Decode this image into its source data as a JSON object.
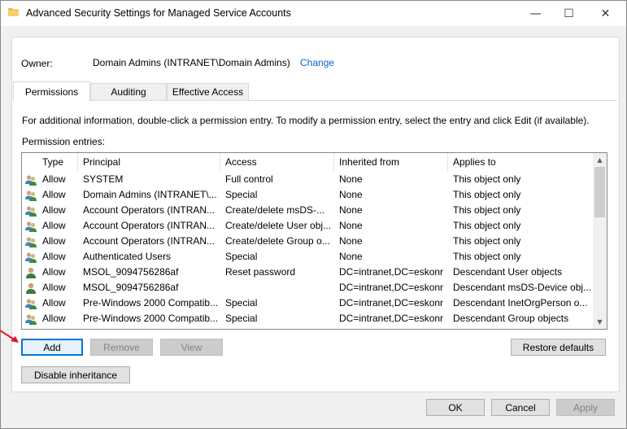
{
  "window": {
    "title": "Advanced Security Settings for Managed Service Accounts",
    "minimize_glyph": "—",
    "maximize_glyph": "☐",
    "close_glyph": "✕"
  },
  "owner": {
    "label": "Owner:",
    "value": "Domain Admins (INTRANET\\Domain Admins)",
    "change_link": "Change"
  },
  "tabs": [
    {
      "label": "Permissions",
      "active": true
    },
    {
      "label": "Auditing",
      "active": false
    },
    {
      "label": "Effective Access",
      "active": false
    }
  ],
  "permissions": {
    "info_text": "For additional information, double-click a permission entry. To modify a permission entry, select the entry and click Edit (if available).",
    "entries_label": "Permission entries:",
    "columns": [
      "Type",
      "Principal",
      "Access",
      "Inherited from",
      "Applies to"
    ],
    "rows": [
      {
        "icon": "group-icon",
        "type": "Allow",
        "principal": "SYSTEM",
        "access": "Full control",
        "inherited": "None",
        "applies": "This object only"
      },
      {
        "icon": "group-icon",
        "type": "Allow",
        "principal": "Domain Admins (INTRANET\\...",
        "access": "Special",
        "inherited": "None",
        "applies": "This object only"
      },
      {
        "icon": "group-icon",
        "type": "Allow",
        "principal": "Account Operators (INTRAN...",
        "access": "Create/delete msDS-...",
        "inherited": "None",
        "applies": "This object only"
      },
      {
        "icon": "group-icon",
        "type": "Allow",
        "principal": "Account Operators (INTRAN...",
        "access": "Create/delete User obj...",
        "inherited": "None",
        "applies": "This object only"
      },
      {
        "icon": "group-icon",
        "type": "Allow",
        "principal": "Account Operators (INTRAN...",
        "access": "Create/delete Group o...",
        "inherited": "None",
        "applies": "This object only"
      },
      {
        "icon": "group-icon",
        "type": "Allow",
        "principal": "Authenticated Users",
        "access": "Special",
        "inherited": "None",
        "applies": "This object only"
      },
      {
        "icon": "user-icon",
        "type": "Allow",
        "principal": "MSOL_9094756286af",
        "access": "Reset password",
        "inherited": "DC=intranet,DC=eskonr",
        "applies": "Descendant User objects"
      },
      {
        "icon": "user-icon",
        "type": "Allow",
        "principal": "MSOL_9094756286af",
        "access": "",
        "inherited": "DC=intranet,DC=eskonr",
        "applies": "Descendant msDS-Device obj..."
      },
      {
        "icon": "group-icon",
        "type": "Allow",
        "principal": "Pre-Windows 2000 Compatib...",
        "access": "Special",
        "inherited": "DC=intranet,DC=eskonr",
        "applies": "Descendant InetOrgPerson o..."
      },
      {
        "icon": "group-icon",
        "type": "Allow",
        "principal": "Pre-Windows 2000 Compatib...",
        "access": "Special",
        "inherited": "DC=intranet,DC=eskonr",
        "applies": "Descendant Group objects"
      }
    ]
  },
  "buttons": {
    "add": "Add",
    "remove": "Remove",
    "view": "View",
    "restore_defaults": "Restore defaults",
    "disable_inheritance": "Disable inheritance",
    "ok": "OK",
    "cancel": "Cancel",
    "apply": "Apply"
  },
  "colors": {
    "link": "#0066cc",
    "focus_border": "#0078d7",
    "annotation_arrow": "#e81123"
  }
}
